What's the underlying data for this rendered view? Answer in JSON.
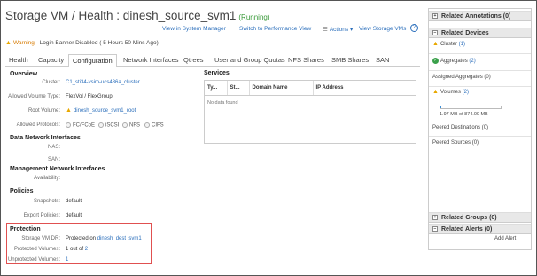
{
  "header": {
    "title": "Storage VM / Health : dinesh_source_svm1",
    "status": "(Running)"
  },
  "actions": {
    "view_in_system_manager": "View in System Manager",
    "switch_to_performance_view": "Switch to Performance View",
    "actions_menu": "Actions ▾",
    "view_storage_vms": "View Storage VMs",
    "help": "?"
  },
  "warning": {
    "label": "Warning",
    "text": " - Login Banner Disabled ( 5 Hours 50 Mins Ago)"
  },
  "tabs": [
    "Health",
    "Capacity",
    "Configuration",
    "Network Interfaces",
    "Qtrees",
    "User and Group Quotas",
    "NFS Shares",
    "SMB Shares",
    "SAN"
  ],
  "overview": {
    "heading": "Overview",
    "cluster_label": "Cluster:",
    "cluster_value": "C1_sti34-vsim-ucs486a_cluster",
    "allowed_volume_type_label": "Allowed Volume Type:",
    "allowed_volume_type_value": "FlexVol / FlexGroup",
    "root_volume_label": "Root Volume:",
    "root_volume_value": "dinesh_source_svm1_root",
    "allowed_protocols_label": "Allowed Protocols:",
    "protocols": [
      "FC/FCoE",
      "iSCSI",
      "NFS",
      "CIFS"
    ]
  },
  "services": {
    "heading": "Services",
    "columns": [
      "Ty...",
      "St...",
      "Domain Name",
      "IP Address"
    ],
    "empty_text": "No data found"
  },
  "data_network": {
    "heading": "Data Network Interfaces",
    "nas_label": "NAS:",
    "san_label": "SAN:"
  },
  "management_network": {
    "heading": "Management Network Interfaces",
    "availability_label": "Availability:"
  },
  "policies": {
    "heading": "Policies",
    "snapshots_label": "Snapshots:",
    "snapshots_value": "default",
    "export_policies_label": "Export Policies:",
    "export_policies_value": "default"
  },
  "protection": {
    "heading": "Protection",
    "storage_vm_dr_label": "Storage VM DR:",
    "storage_vm_dr_prefix": "Protected on ",
    "storage_vm_dr_link": "dinesh_dest_svm1",
    "protected_volumes_label": "Protected Volumes:",
    "protected_volumes_prefix": "1 out of ",
    "protected_volumes_link": "2",
    "unprotected_volumes_label": "Unprotected Volumes:",
    "unprotected_volumes_value": "1"
  },
  "right_panel": {
    "related_annotations": "Related Annotations (0)",
    "related_devices": "Related Devices",
    "cluster_label": "Cluster",
    "cluster_count": "(1)",
    "aggregates_label": "Aggregates",
    "aggregates_count": "(2)",
    "assigned_aggregates": "Assigned Aggregates (0)",
    "volumes_label": "Volumes",
    "volumes_count": "(2)",
    "volumes_capacity": "1.97 MB of 874.00 MB",
    "volumes_usage_fraction": 0.0023,
    "peered_destinations": "Peered Destinations (0)",
    "peered_sources": "Peered Sources (0)",
    "related_groups": "Related Groups (0)",
    "related_alerts": "Related Alerts (0)",
    "add_alert": "Add Alert"
  }
}
